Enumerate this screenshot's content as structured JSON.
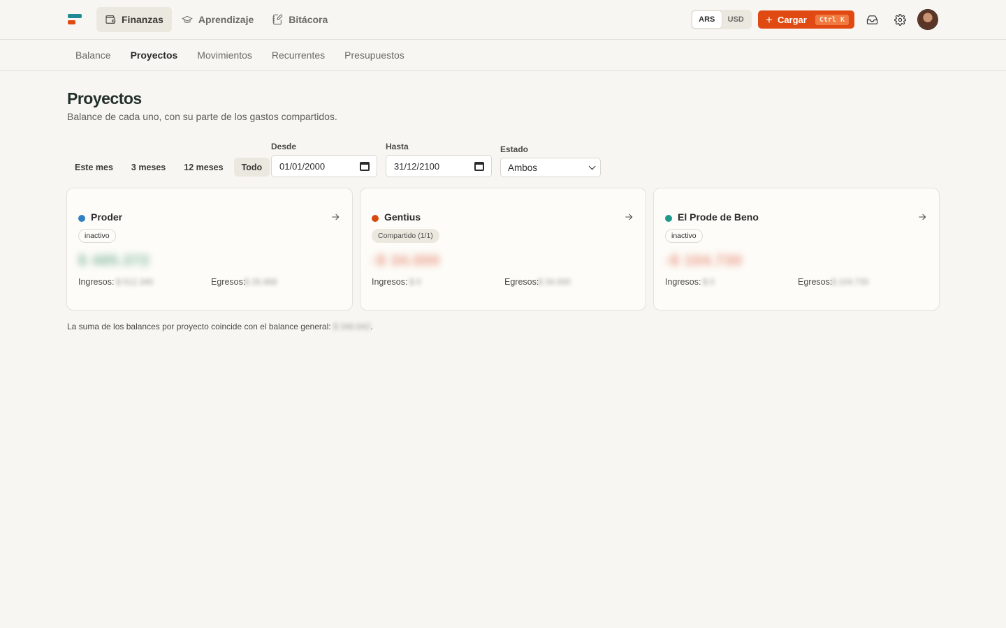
{
  "nav": {
    "items": [
      {
        "label": "Finanzas",
        "icon": "wallet-icon",
        "active": true
      },
      {
        "label": "Aprendizaje",
        "icon": "graduation-cap-icon",
        "active": false
      },
      {
        "label": "Bitácora",
        "icon": "notebook-pen-icon",
        "active": false
      }
    ],
    "currency": {
      "options": [
        "ARS",
        "USD"
      ],
      "selected": "ARS"
    },
    "cargar": {
      "label": "Cargar",
      "shortcut": "Ctrl K"
    }
  },
  "subnav": {
    "tabs": [
      {
        "label": "Balance",
        "active": false
      },
      {
        "label": "Proyectos",
        "active": true
      },
      {
        "label": "Movimientos",
        "active": false
      },
      {
        "label": "Recurrentes",
        "active": false
      },
      {
        "label": "Presupuestos",
        "active": false
      }
    ]
  },
  "page": {
    "title": "Proyectos",
    "subtitle": "Balance de cada uno, con su parte de los gastos compartidos."
  },
  "filters": {
    "ranges": [
      {
        "label": "Este mes",
        "active": false
      },
      {
        "label": "3 meses",
        "active": false
      },
      {
        "label": "12 meses",
        "active": false
      },
      {
        "label": "Todo",
        "active": true
      }
    ],
    "desde": {
      "label": "Desde",
      "value": "01/01/2000"
    },
    "hasta": {
      "label": "Hasta",
      "value": "31/12/2100"
    },
    "estado": {
      "label": "Estado",
      "value": "Ambos"
    }
  },
  "projects": [
    {
      "name": "Proder",
      "color": "#2f7fc1",
      "badge": "inactivo",
      "badge_style": "outline",
      "amount": "$ 485.372",
      "amount_color": "#7fb59a",
      "ingresos_label": "Ingresos:",
      "ingresos": "$ 512.340",
      "egresos_label": "Egresos:",
      "egresos": "$ 26.968"
    },
    {
      "name": "Gentius",
      "color": "#d9480f",
      "badge": "Compartido (1/1)",
      "badge_style": "filled",
      "amount": "-$ 34.000",
      "amount_color": "#e8907a",
      "ingresos_label": "Ingresos:",
      "ingresos": "$ 0",
      "egresos_label": "Egresos:",
      "egresos": "$ 34.000"
    },
    {
      "name": "El Prode de Beno",
      "color": "#1f9a8a",
      "badge": "inactivo",
      "badge_style": "outline",
      "amount": "-$ 104.730",
      "amount_color": "#e8907a",
      "ingresos_label": "Ingresos:",
      "ingresos": "$ 0",
      "egresos_label": "Egresos:",
      "egresos": "$ 104.730"
    }
  ],
  "footnote": {
    "text": "La suma de los balances por proyecto coincide con el balance general:",
    "value": "$ 346.642",
    "end": "."
  }
}
